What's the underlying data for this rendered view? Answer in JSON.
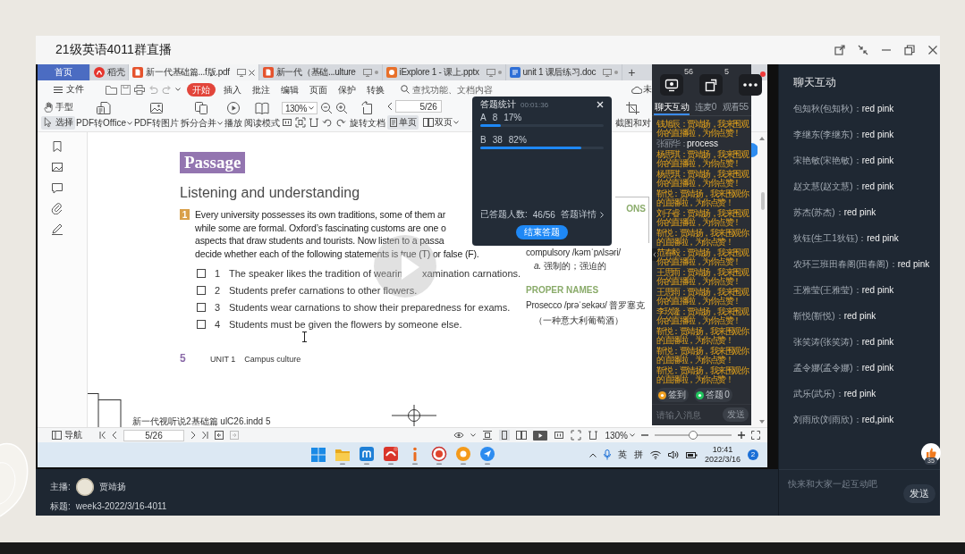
{
  "window": {
    "title": "21级英语4011群直播"
  },
  "screen": {
    "tabs": [
      {
        "label": "首页",
        "kind": "home",
        "selected": false
      },
      {
        "label": "稻壳",
        "kind": "docer",
        "selected": false
      },
      {
        "label": "新一代基础篇...f版.pdf",
        "kind": "pdf",
        "selected": true
      },
      {
        "label": "新一代（基础...ulture",
        "kind": "pdf",
        "selected": false
      },
      {
        "label": "iExplore 1 - 课上.pptx",
        "kind": "ppt",
        "selected": false
      },
      {
        "label": "unit 1 课后练习.doc",
        "kind": "doc",
        "selected": false
      }
    ],
    "new_tab": "+",
    "file_menu": "文件",
    "menu": [
      {
        "label": "开始",
        "selected": true
      },
      {
        "label": "插入",
        "selected": false
      },
      {
        "label": "批注",
        "selected": false
      },
      {
        "label": "编辑",
        "selected": false
      },
      {
        "label": "页面",
        "selected": false
      },
      {
        "label": "保护",
        "selected": false
      },
      {
        "label": "转换",
        "selected": false
      }
    ],
    "search": {
      "placeholder": "查找功能、文档内容"
    },
    "cloud_status": "未",
    "pointer_tools": [
      {
        "label": "手型",
        "kind": "hand",
        "selected": false
      },
      {
        "label": "选择",
        "kind": "select",
        "selected": true
      }
    ],
    "ribbon": [
      {
        "label": "PDF转Office",
        "kind": "pdf_office",
        "dropdown": true
      },
      {
        "label": "PDF转图片",
        "kind": "pdf_image",
        "dropdown": false
      },
      {
        "label": "拆分合并",
        "kind": "split",
        "dropdown": true
      },
      {
        "label": "播放",
        "kind": "play",
        "dropdown": false
      },
      {
        "label": "阅读模式",
        "kind": "read",
        "dropdown": false
      }
    ],
    "zoom": "130%",
    "rotate": "旋转文档",
    "page_field": "5/26",
    "view_modes": [
      {
        "label": "单页",
        "kind": "single",
        "selected": true,
        "dropdown": false
      },
      {
        "label": "双页",
        "kind": "double",
        "selected": false,
        "dropdown": true
      }
    ],
    "crop_compare": "截图和对",
    "document": {
      "heading": "Passage",
      "subheading": "Listening and understanding",
      "exercise_number": "1",
      "instructions": [
        "Every university possesses its own traditions, some of them ar",
        "while some are formal. Oxford’s fascinating customs are one o",
        "aspects that draw students and tourists. Now listen to a passa",
        "decide whether each of the following statements is true (T) or false (F)."
      ],
      "statements": [
        {
          "number": "1",
          "text": "The speaker likes the tradition of wearin",
          "text_after_play_button": "xamination carnations.",
          "checked": false
        },
        {
          "number": "2",
          "text": "Students prefer carnations to other flowers.",
          "checked": false
        },
        {
          "number": "3",
          "text": "Students wear carnations to show their preparedness for exams.",
          "checked": false
        },
        {
          "number": "4",
          "text": "Students must be given the flowers by someone else.",
          "checked": false
        }
      ],
      "box_heading": "ONS",
      "glossary": [
        {
          "term": "compulsory /kəmˈpʌlsəri/",
          "meaning": "*a.* 强制的；强迫的"
        }
      ],
      "proper_names_heading": "PROPER NAMES",
      "proper_names": [
        {
          "term": "Prosecco /prəˈsekəʊ/ 普罗塞克",
          "meaning": "（一种意大利葡萄酒）"
        }
      ],
      "page_number": "5",
      "unit": "UNIT 1",
      "unit_title": "Campus culture",
      "slug": "新一代视听说2基础篇 ulC26.indd  5"
    },
    "status_bar": {
      "navigation": "导航",
      "page_field": "5/26",
      "zoom": "130%",
      "zoom_slider": {
        "level": 0.5
      }
    },
    "taskbar": {
      "input_language": "英",
      "input_method": "拼",
      "time": "10:41",
      "date": "2022/3/16",
      "notifications": "2"
    }
  },
  "vote_popup": {
    "title": "答题统计",
    "timer": "00:01:36",
    "options": [
      {
        "label": "A",
        "count": "8",
        "percent": "17%",
        "level": 0.17
      },
      {
        "label": "B",
        "count": "38",
        "percent": "82%",
        "level": 0.82
      }
    ],
    "answered_label": "已答题人数:",
    "answered": "46/56",
    "details_link": "答题详情",
    "end_button": "结束答题"
  },
  "stream_panel": {
    "stats": [
      "56",
      "5"
    ],
    "tabs": [
      {
        "label": "聊天互动",
        "selected": true
      },
      {
        "label": "连麦0",
        "selected": false
      },
      {
        "label": "观看55",
        "selected": false
      }
    ],
    "messages": [
      {
        "kind": "cheer",
        "author": "钱旭辰：",
        "text": "贾靖扬，我来围观你的直播啦，为你点赞！"
      },
      {
        "kind": "chat",
        "author": "张丽华：",
        "text": "process"
      },
      {
        "kind": "cheer",
        "author": "杨思琪：",
        "text": "贾靖扬，我来围观你的直播啦，为你点赞！"
      },
      {
        "kind": "cheer",
        "author": "杨思琪：",
        "text": "贾靖扬，我来围观你的直播啦，为你点赞！"
      },
      {
        "kind": "cheer",
        "author": "靳悦：",
        "text": "贾靖扬，我来围观你的直播啦，为你点赞！"
      },
      {
        "kind": "cheer",
        "author": "刘子睿：",
        "text": "贾靖扬，我来围观你的直播啦，为你点赞！"
      },
      {
        "kind": "cheer",
        "author": "靳悦：",
        "text": "贾靖扬，我来围观你的直播啦，为你点赞！"
      },
      {
        "kind": "cheer",
        "author": "范春毅：",
        "text": "贾靖扬，我来围观你的直播啦，为你点赞！"
      },
      {
        "kind": "cheer",
        "author": "王思雨：",
        "text": "贾靖扬，我来围观你的直播啦，为你点赞！"
      },
      {
        "kind": "cheer",
        "author": "王思雨：",
        "text": "贾靖扬，我来围观你的直播啦，为你点赞！"
      },
      {
        "kind": "cheer",
        "author": "李玖隆：",
        "text": "贾靖扬，我来围观你的直播啦，为你点赞！"
      },
      {
        "kind": "cheer",
        "author": "靳悦：",
        "text": "贾靖扬，我来围观你的直播啦，为你点赞！"
      },
      {
        "kind": "cheer",
        "author": "靳悦：",
        "text": "贾靖扬，我来围观你的直播啦，为你点赞！"
      },
      {
        "kind": "cheer",
        "author": "靳悦：",
        "text": "贾靖扬，我来围观你的直播啦，为你点赞！"
      }
    ],
    "quick_actions": [
      {
        "label": "签到",
        "color": "#f0a020"
      },
      {
        "label": "答题 0",
        "color": "#22c55e"
      }
    ],
    "input": {
      "placeholder": "请输入消息"
    },
    "send_button": "发送"
  },
  "host_info": {
    "host_label": "主播:",
    "host_name": "贾靖扬",
    "title_label": "标题:",
    "title": "week3-2022/3/16-4011"
  },
  "chat": {
    "title": "聊天互动",
    "messages": [
      {
        "author": "包知秋(包知秋)：",
        "text": "red pink"
      },
      {
        "author": "李继东(李继东)：",
        "text": "red pink"
      },
      {
        "author": "宋艳敏(宋艳敏)：",
        "text": "red pink"
      },
      {
        "author": "赵文慧(赵文慧)：",
        "text": "red pink"
      },
      {
        "author": "苏杰(苏杰)：",
        "text": "red pink"
      },
      {
        "author": "狄钰(生工1狄钰)：",
        "text": "red pink"
      },
      {
        "author": "农环三班田春阁(田春阁)：",
        "text": "red pink"
      },
      {
        "author": "王雅莹(王雅莹)：",
        "text": "red pink"
      },
      {
        "author": "靳悦(靳悦)：",
        "text": "red pink"
      },
      {
        "author": "张笑涛(张笑涛)：",
        "text": "red pink"
      },
      {
        "author": "孟令娜(孟令娜)：",
        "text": "red pink"
      },
      {
        "author": "武乐(武乐)：",
        "text": "red pink"
      },
      {
        "author": "刘雨欣(刘雨欣)：",
        "text": "red,pink"
      }
    ],
    "likes": "35",
    "input": {
      "placeholder": "快来和大家一起互动吧"
    },
    "send_button": "发送"
  }
}
